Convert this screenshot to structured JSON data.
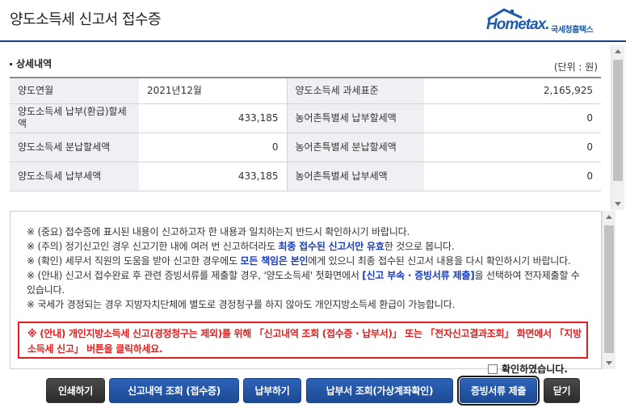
{
  "header": {
    "title": "양도소득세 신고서 접수증",
    "logo_word": "Hometax.",
    "logo_org": "국세청홈택스"
  },
  "section": {
    "title": "상세내역",
    "unit": "(단위 : 원)"
  },
  "detail_rows": [
    {
      "label1": "양도연월",
      "value1": "2021년12월",
      "label2": "양도소득세 과세표준",
      "value2": "2,165,925"
    },
    {
      "label1": "양도소득세 납부(환급)할세액",
      "value1": "433,185",
      "label2": "농어촌특별세 납부할세액",
      "value2": "0"
    },
    {
      "label1": "양도소득세 분납할세액",
      "value1": "0",
      "label2": "농어촌특별세 분납할세액",
      "value2": "0"
    },
    {
      "label1": "양도소득세 납부세액",
      "value1": "433,185",
      "label2": "농어촌특별세 납부세액",
      "value2": "0"
    }
  ],
  "notices": {
    "n1": "※ (중요) 접수증에 표시된 내용이 신고하고자 한 내용과 일치하는지 반드시 확인하시기 바랍니다.",
    "n2_pre": "※ (주의) 정기신고인 경우 신고기한 내에 여러 번 신고하더라도 ",
    "n2_bold": "최종 접수된 신고서만 유효",
    "n2_post": "한 것으로 봅니다.",
    "n3_pre": "※ (확인) 세무서 직원의 도움을 받아 신고한 경우에도 ",
    "n3_bold": "모든 책임은 본인",
    "n3_post": "에게 있으니 최종 접수된 신고서 내용을 다시 확인하시기 바랍니다.",
    "n4_pre": "※ (안내) 신고서 접수완료 후 관련 증빙서류를 제출할 경우, '양도소득세' 첫화면에서 ",
    "n4_bold": "[신고 부속 · 증빙서류 제출]",
    "n4_post": "을 선택하여 전자제출할 수 있습니다.",
    "n5": "※ 국세가 경정되는 경우 지방자치단체에 별도로 경정청구를 하지 않아도 개인지방소득세 환급이 가능합니다.",
    "red": "※ (안내) 개인지방소득세 신고(경정청구는 제외)를 위해 「신고내역 조회 (접수증 · 납부서)」 또는 「전자신고결과조회」 화면에서 「지방소득세 신고」 버튼을 클릭하세요."
  },
  "confirm_label": "확인하였습니다.",
  "buttons": {
    "print": "인쇄하기",
    "history": "신고내역 조회 (접수증)",
    "pay": "납부하기",
    "bill": "납부서 조회(가상계좌확인)",
    "evidence": "증빙서류 제출",
    "close": "닫기"
  },
  "colors": {
    "brand_blue": "#1f5ba8",
    "notice_red": "#e02020",
    "button_dark": "#333333",
    "button_blue": "#2559a8"
  }
}
